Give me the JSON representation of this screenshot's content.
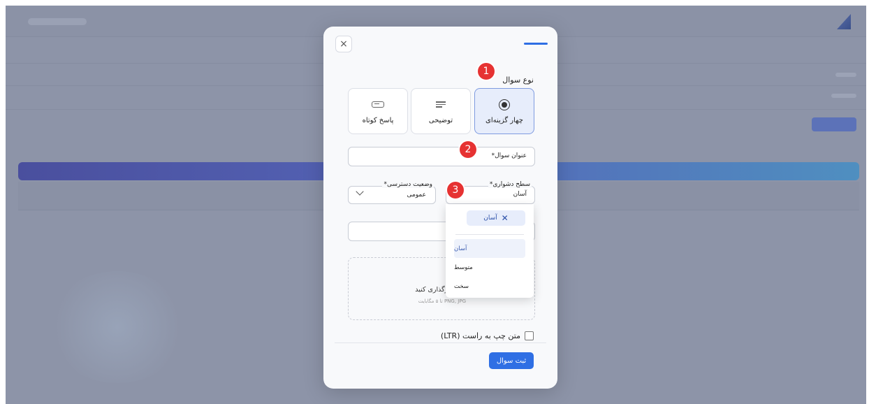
{
  "modal": {
    "close_label": "×",
    "question_type_label": "نوع سوال",
    "question_types": [
      {
        "label": "چهار گزینه‌ای",
        "icon": "radio-icon",
        "selected": true
      },
      {
        "label": "توضیحی",
        "icon": "text-lines-icon",
        "selected": false
      },
      {
        "label": "پاسخ کوتاه",
        "icon": "input-field-icon",
        "selected": false
      }
    ],
    "title_field_label": "عنوان سوال*",
    "difficulty": {
      "legend": "سطح دشواری*",
      "value": "آسان",
      "selected_chip": "آسان",
      "options": [
        "آسان",
        "متوسط",
        "سخت"
      ]
    },
    "access": {
      "legend": "وضعیت دسترسی*",
      "value": "عمومی"
    },
    "upload": {
      "text": "اینجا بارگذاری کنید",
      "hint": "PNG, JPG تا ۵ مگابایت"
    },
    "ltr_label": "متن چپ به راست (LTR)",
    "submit_label": "ثبت سوال"
  },
  "markers": [
    "1",
    "2",
    "3"
  ],
  "colors": {
    "accent": "#2f6fe4",
    "marker": "#e63232",
    "selected_card": "#e7edfb"
  }
}
